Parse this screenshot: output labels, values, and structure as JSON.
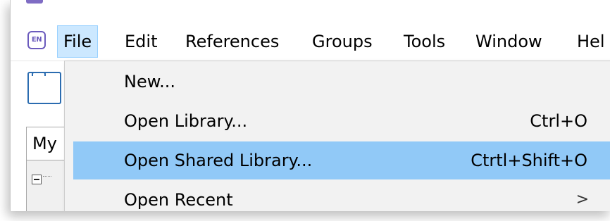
{
  "window": {
    "title_fragment": "  ‘ /  /    ‘  /  ‘  /"
  },
  "menubar": {
    "logo_text": "EN",
    "items": [
      {
        "label": "File"
      },
      {
        "label": "Edit"
      },
      {
        "label": "References"
      },
      {
        "label": "Groups"
      },
      {
        "label": "Tools"
      },
      {
        "label": "Window"
      },
      {
        "label": "Hel"
      }
    ]
  },
  "left_panel": {
    "tab_label": "My"
  },
  "file_menu": {
    "items": [
      {
        "label": "New...",
        "shortcut": ""
      },
      {
        "label": "Open Library...",
        "shortcut": "Ctrl+O"
      },
      {
        "label": "Open Shared Library...",
        "shortcut": "Ctrtl+Shift+O"
      },
      {
        "label": "Open Recent",
        "submenu_indicator": ">"
      }
    ]
  },
  "colors": {
    "highlight": "#91c9f7",
    "menu_active": "#cce8ff",
    "logo": "#6b5bbd"
  }
}
